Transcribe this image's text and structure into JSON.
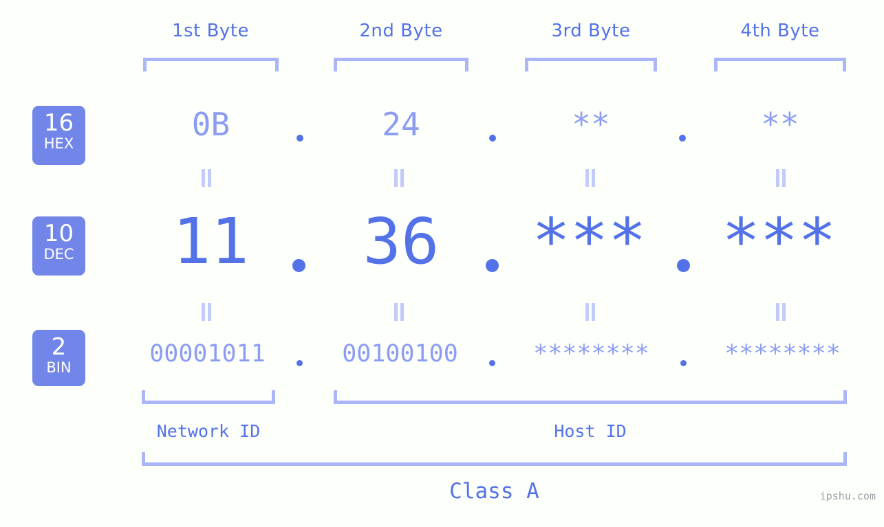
{
  "meta": {
    "background_color": "#fdfffa",
    "accent_strong": "#5472e8",
    "accent_light": "#8c9cf2",
    "accent_faint": "#aab6f7",
    "badge_color": "#7186e8",
    "watermark": "ipshu.com"
  },
  "byte_headers": [
    {
      "label": "1st Byte"
    },
    {
      "label": "2nd Byte"
    },
    {
      "label": "3rd Byte"
    },
    {
      "label": "4th Byte"
    }
  ],
  "radix_badges": [
    {
      "number": "16",
      "label": "HEX"
    },
    {
      "number": "10",
      "label": "DEC"
    },
    {
      "number": "2",
      "label": "BIN"
    }
  ],
  "rows": {
    "hex": {
      "radix": "16",
      "values": [
        "0B",
        "24",
        "**",
        "**"
      ],
      "separator": "."
    },
    "dec": {
      "radix": "10",
      "values": [
        "11",
        "36",
        "***",
        "***"
      ],
      "separator": "."
    },
    "bin": {
      "radix": "2",
      "values": [
        "00001011",
        "00100100",
        "********",
        "********"
      ],
      "separator": "."
    }
  },
  "equality_symbol": "=",
  "sections": {
    "network_id": "Network ID",
    "host_id": "Host ID",
    "class": "Class A"
  },
  "address": {
    "hex": "0B.24.**.**",
    "dec": "11.36.***.***",
    "bin": "00001011.00100100.********.********"
  }
}
